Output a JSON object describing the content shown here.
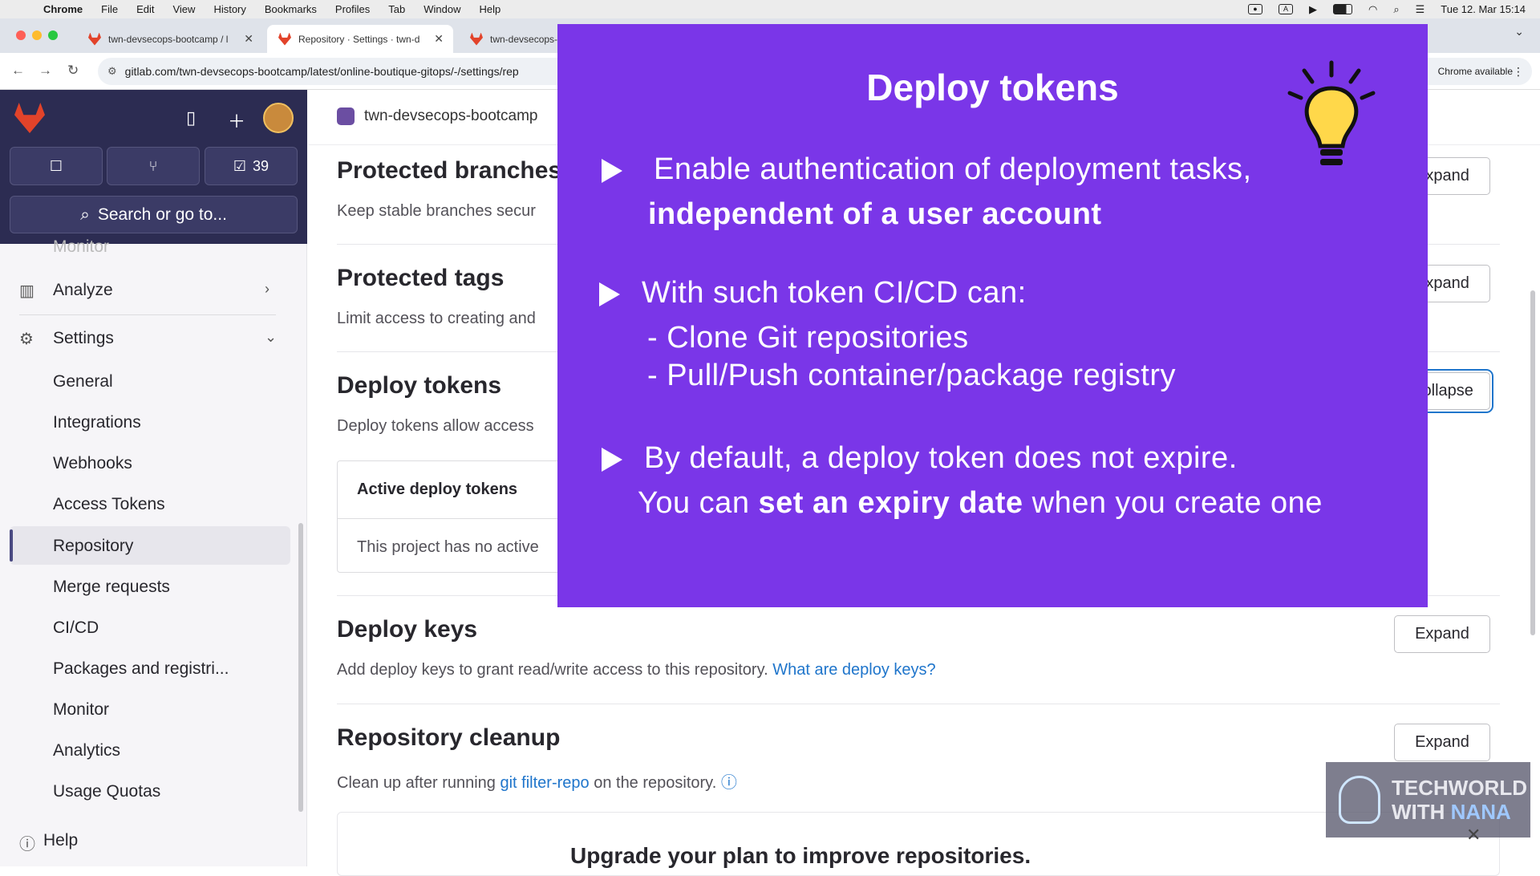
{
  "menubar": {
    "app": "Chrome",
    "items": [
      "File",
      "Edit",
      "View",
      "History",
      "Bookmarks",
      "Profiles",
      "Tab",
      "Window",
      "Help"
    ],
    "datetime": "Tue 12. Mar  15:14"
  },
  "tabs": [
    {
      "title": "twn-devsecops-bootcamp / l"
    },
    {
      "title": "Repository · Settings · twn-d"
    },
    {
      "title": "twn-devsecops-"
    }
  ],
  "address": {
    "url": "gitlab.com/twn-devsecops-bootcamp/latest/online-boutique-gitops/-/settings/rep",
    "update_label": "Chrome available"
  },
  "sidebar": {
    "todo_count": "39",
    "search_label": "Search or go to...",
    "faded_item": "Monitor",
    "analyze": "Analyze",
    "settings": "Settings",
    "sub_items": [
      "General",
      "Integrations",
      "Webhooks",
      "Access Tokens",
      "Repository",
      "Merge requests",
      "CI/CD",
      "Packages and registri...",
      "Monitor",
      "Analytics",
      "Usage Quotas"
    ],
    "help": "Help"
  },
  "main": {
    "breadcrumb": "twn-devsecops-bootcamp",
    "sections": {
      "protected_branches": {
        "title": "Protected branches",
        "desc": "Keep stable branches secur",
        "button": "Expand"
      },
      "protected_tags": {
        "title": "Protected tags",
        "desc": "Limit access to creating and",
        "button": "Expand"
      },
      "deploy_tokens": {
        "title": "Deploy tokens",
        "desc": "Deploy tokens allow access",
        "button": "Collapse",
        "card_title": "Active deploy tokens",
        "card_body": "This project has no active"
      },
      "deploy_keys": {
        "title": "Deploy keys",
        "desc": "Add deploy keys to grant read/write access to this repository.",
        "link": "What are deploy keys?",
        "button": "Expand"
      },
      "repo_cleanup": {
        "title": "Repository cleanup",
        "desc_pre": "Clean up after running",
        "link": "git filter-repo",
        "desc_post": "on the repository.",
        "button": "Expand"
      }
    },
    "upgrade": "Upgrade your plan to improve repositories."
  },
  "overlay": {
    "title": "Deploy tokens",
    "b1_line1": "Enable authentication of deployment tasks,",
    "b1_line2": "independent of a user account",
    "b2_line1": "With such token CI/CD can:",
    "b2_item1": "- Clone Git repositories",
    "b2_item2": "- Pull/Push container/package registry",
    "b3_line1": "By default, a deploy token does not expire.",
    "b3_pre": "You can",
    "b3_bold": "set an expiry date",
    "b3_post": "when you create one",
    "bg_color": "#7a36e8"
  },
  "watermark": {
    "line1": "TECHWORLD",
    "line2_a": "WITH",
    "line2_b": "NANA"
  }
}
